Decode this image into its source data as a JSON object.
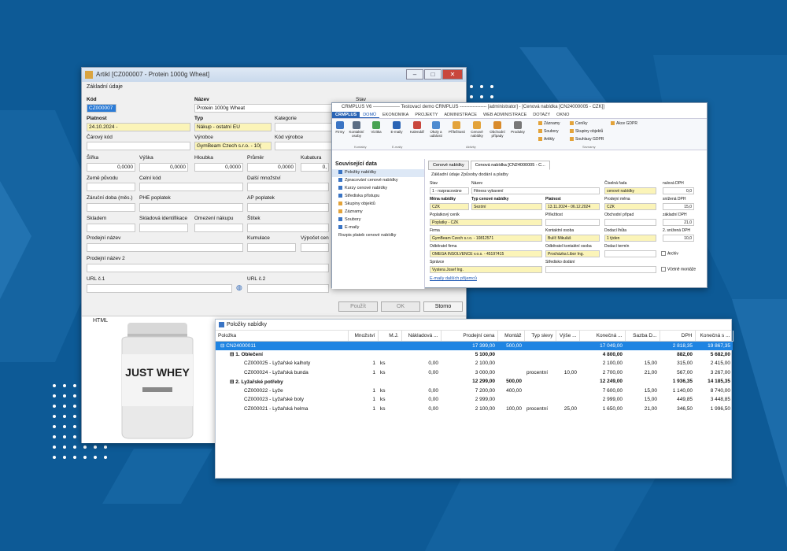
{
  "article_window": {
    "title": "Artikl [CZ000007 - Protein 1000g Wheat]",
    "section": "Základní údaje",
    "fields": {
      "kod_label": "Kód",
      "kod_value": "CZ000007",
      "nazev_label": "Název",
      "nazev_value": "Protein 1000g Wheat",
      "stav_label": "Stav",
      "platnost_label": "Platnost",
      "platnost_value": "24.10.2024 -",
      "typ_label": "Typ",
      "typ_value": "Nákup - ostatní EU",
      "kategorie_label": "Kategorie",
      "carovy_label": "Čárový kód",
      "vyrobce_label": "Výrobce",
      "vyrobce_value": "GymBeam Czech s.r.o. - 10(",
      "kod_vyrobce_label": "Kód výrobce",
      "sirka_label": "Šířka",
      "sirka_value": "0,0000",
      "vyska_label": "Výška",
      "vyska_value": "0,0000",
      "hloubka_label": "Hloubka",
      "hloubka_value": "0,0000",
      "prumer_label": "Průměr",
      "prumer_value": "0,0000",
      "kubatura_label": "Kubatura",
      "kubatura_value": "0,",
      "zeme_label": "Země původu",
      "celni_label": "Celní kód",
      "dalsi_label": "Další množství",
      "zarucni_label": "Záruční doba (měs.)",
      "phe_label": "PHE poplatek",
      "ap_label": "AP poplatek",
      "skladem_label": "Skladem",
      "skladova_label": "Skladová identifikace",
      "omezeni_label": "Omezení nákupu",
      "stitek_label": "Štítek",
      "prodejni_label": "Prodejní název",
      "kumulace_label": "Kumulace",
      "vypocet_label": "Výpočet cen",
      "prodejni2_label": "Prodejní název 2",
      "url1_label": "URL č.1",
      "url2_label": "URL č.2"
    },
    "buttons": {
      "pouzit": "Použít",
      "ok": "OK",
      "storno": "Storno"
    },
    "html_label": "HTML",
    "product_text": "JUST WHEY"
  },
  "crm_window": {
    "title": "CRMPLUS V6 ----------------- Testovací demo CRMPLUS ----------------- [administrator] - [Cenová nabídka [CN24000005 - CZK]]",
    "menu": [
      "CRMPLUS",
      "DOMŮ",
      "EKONOMIKA",
      "PROJEKTY",
      "ADMINISTRACE",
      "WEB ADMINISTRACE",
      "DOTAZY",
      "OKNO"
    ],
    "ribbon_buttons": [
      "Firmy",
      "Kontaktní osoby",
      "Vizitka",
      "E-maily",
      "Kalendář",
      "Úkoly a události",
      "Příležitosti",
      "Cenové nabídky",
      "Obchodní případy",
      "Produkty"
    ],
    "ribbon_groups": [
      "Kontakty",
      "E-maily",
      "Aktivity"
    ],
    "ribbon_small": [
      "Záznamy",
      "Soubory",
      "Artikly",
      "Ceníky",
      "Skupiny objektů",
      "Souhlasy GDPR",
      "Akce GDPR"
    ],
    "ribbon_small_group": "Seznamy",
    "sidebar_title": "Související data",
    "sidebar_items": [
      "Položky nabídky",
      "Zpracování cenové nabídky",
      "Kurzy cenové nabídky",
      "Střediska přístupu",
      "Skupiny objektů",
      "Záznamy",
      "Soubory",
      "E-maily",
      "Rozpis plateb cenové nabídky"
    ],
    "tabs": [
      "Cenové nabídky",
      "Cenová nabídka [CN24000005 - C..."
    ],
    "subtabs": "Základní údaje    Způsoby dodání a platby",
    "labels": {
      "stav": "Stav",
      "nazev": "Název",
      "cislo_rada": "Číselná řada",
      "nulova_dph": "nulová DPH",
      "mena": "Měna nabídky",
      "typ": "Typ cenové nabídky",
      "platnost": "Platnost",
      "prodejni_mena": "Prodejní měna",
      "snizena_dph": "snížená DPH",
      "poplatkovy": "Poplatkový ceník",
      "prilezitost": "Příležitost",
      "obchodni_pripad": "Obchodní případ",
      "zakladni_dph": "základní DPH",
      "firma": "Firma",
      "kontaktni_osoba": "Kontaktní osoba",
      "dodaci_lhuta": "Dodací lhůta",
      "snizena2": "2. snížená DPH",
      "odberatel": "Odběratel firma",
      "odberatel_osoba": "Odběratel kontaktní osoba",
      "dodaci_termin": "Dodací termín",
      "archiv": "Archiv",
      "spravce": "Správce",
      "stredisko": "Středisko dodání",
      "vcetne": "Včetně montáže"
    },
    "values": {
      "stav": "1 - rozpracováno",
      "nazev": "Fitness vybavení",
      "cislo_rada": "cenové nabídky",
      "nulova_dph": "0,0",
      "mena": "CZK",
      "typ": "Sezóní",
      "platnost": "13.11.2024 - 06.12.2024",
      "prodejni_mena": "CZK",
      "snizena_dph": "15,0",
      "poplatkovy": "Poplatky - CZK",
      "zakladni_dph": "21,0",
      "firma": "GymBeam Czech s.r.o. - 10812571",
      "kontaktni_osoba": "Bulíč Mikuláš",
      "dodaci_lhuta": "1 týden",
      "snizena2": "10,0",
      "odberatel": "OMEGA INSOLVENCE v.o.s. - 45197415",
      "odberatel_osoba": "Procházka Libor Ing.",
      "spravce": "Vystera Josef Ing."
    },
    "link": "E-maily dalších příjemců"
  },
  "items_window": {
    "title": "Položky nabídky",
    "columns": [
      "Položka",
      "Množství",
      "M.J.",
      "Nákladová ...",
      "Prodejní cena",
      "Montáž",
      "Typ slevy",
      "Výše ...",
      "Konečná ...",
      "Sazba D...",
      "DPH",
      "Konečná s ..."
    ],
    "rows": [
      {
        "kind": "top",
        "cells": [
          "CN24000011",
          "",
          "",
          "",
          "17 399,00",
          "500,00",
          "",
          "",
          "17 049,00",
          "",
          "2 818,35",
          "19 867,35"
        ]
      },
      {
        "kind": "grp",
        "cells": [
          "1. Oblečení",
          "",
          "",
          "",
          "5 100,00",
          "",
          "",
          "",
          "4 800,00",
          "",
          "882,00",
          "5 682,00"
        ]
      },
      {
        "kind": "item",
        "cells": [
          "CZ000025 - Lyžařské kalhoty",
          "1",
          "ks",
          "0,00",
          "2 100,00",
          "",
          "",
          "",
          "2 100,00",
          "15,00",
          "315,00",
          "2 415,00"
        ]
      },
      {
        "kind": "item",
        "cells": [
          "CZ000024 - Lyžařská bunda",
          "1",
          "ks",
          "0,00",
          "3 000,00",
          "",
          "procentní",
          "10,00",
          "2 700,00",
          "21,00",
          "567,00",
          "3 267,00"
        ]
      },
      {
        "kind": "grp",
        "cells": [
          "2. Lyžařské potřeby",
          "",
          "",
          "",
          "12 299,00",
          "500,00",
          "",
          "",
          "12 249,00",
          "",
          "1 936,35",
          "14 185,35"
        ]
      },
      {
        "kind": "item",
        "cells": [
          "CZ000022 - Lyže",
          "1",
          "ks",
          "0,00",
          "7 200,00",
          "400,00",
          "",
          "",
          "7 600,00",
          "15,00",
          "1 140,00",
          "8 740,00"
        ]
      },
      {
        "kind": "item",
        "cells": [
          "CZ000023 - Lyžařské boty",
          "1",
          "ks",
          "0,00",
          "2 999,00",
          "",
          "",
          "",
          "2 999,00",
          "15,00",
          "449,85",
          "3 448,85"
        ]
      },
      {
        "kind": "item",
        "cells": [
          "CZ000021 - Lyžařská helma",
          "1",
          "ks",
          "0,00",
          "2 100,00",
          "100,00",
          "procentní",
          "25,00",
          "1 650,00",
          "21,00",
          "346,50",
          "1 996,50"
        ]
      }
    ]
  },
  "colors": {
    "background": "#0d5a96",
    "selection": "#1f84e2",
    "required": "#fbf4b8"
  }
}
